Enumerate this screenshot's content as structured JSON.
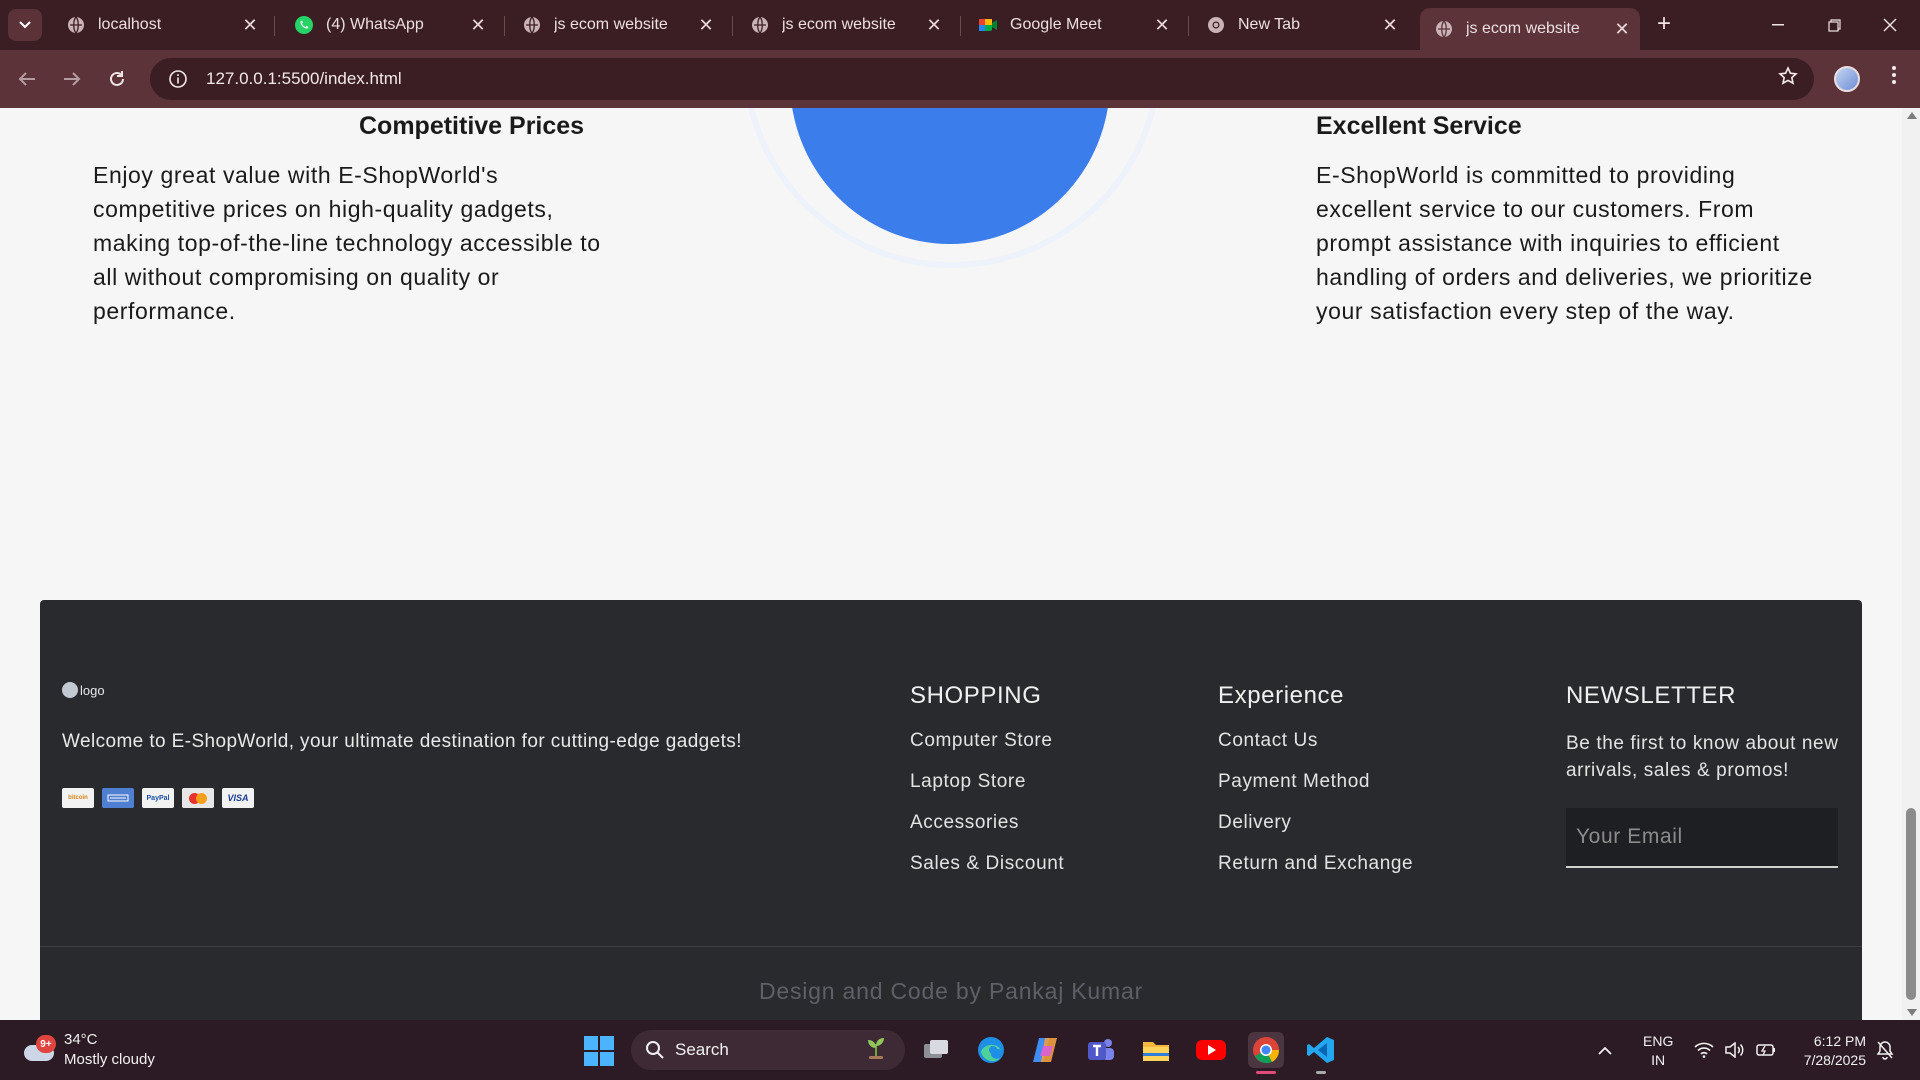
{
  "browser": {
    "tabs": [
      {
        "title": "localhost",
        "icon": "globe-icon",
        "active": false
      },
      {
        "title": "(4) WhatsApp",
        "icon": "whatsapp-icon",
        "active": false
      },
      {
        "title": "js ecom website",
        "icon": "globe-icon",
        "active": false
      },
      {
        "title": "js ecom website",
        "icon": "globe-icon",
        "active": false
      },
      {
        "title": "Google Meet",
        "icon": "google-meet-icon",
        "active": false
      },
      {
        "title": "New Tab",
        "icon": "chrome-icon",
        "active": false
      },
      {
        "title": "js ecom website",
        "icon": "globe-icon",
        "active": true
      }
    ],
    "url": "127.0.0.1:5500/index.html",
    "tab_close_glyph": "✕",
    "new_tab_glyph": "+"
  },
  "features": {
    "left": {
      "title": "Competitive Prices",
      "text": "Enjoy great value with E-ShopWorld's competitive prices on high-quality gadgets, making top-of-the-line technology accessible to all without compromising on quality or performance."
    },
    "right": {
      "title": "Excellent Service",
      "text": "E-ShopWorld is committed to providing excellent service to our customers. From prompt assistance with inquiries to efficient handling of orders and deliveries, we prioritize your satisfaction every step of the way."
    }
  },
  "footer": {
    "logo_alt": "logo",
    "welcome": "Welcome to E-ShopWorld, your ultimate destination for cutting-edge gadgets!",
    "payment_methods": [
      "bitcoin",
      "American Express",
      "PayPal",
      "MasterCard",
      "VISA"
    ],
    "shopping": {
      "heading": "SHOPPING",
      "links": [
        "Computer Store",
        "Laptop Store",
        "Accessories",
        "Sales & Discount"
      ]
    },
    "experience": {
      "heading": "Experience",
      "links": [
        "Contact Us",
        "Payment Method",
        "Delivery",
        "Return and Exchange"
      ]
    },
    "newsletter": {
      "heading": "NEWSLETTER",
      "text": "Be the first to know about new arrivals, sales & promos!",
      "email_placeholder": "Your Email"
    },
    "credit": "Design and Code by Pankaj Kumar"
  },
  "taskbar": {
    "weather": {
      "temp": "34°C",
      "condition": "Mostly cloudy",
      "badge": "9+"
    },
    "search_label": "Search",
    "apps": [
      "task-view-icon",
      "edge-icon",
      "copilot-icon",
      "teams-icon",
      "file-explorer-icon",
      "youtube-icon",
      "chrome-icon",
      "vscode-icon"
    ],
    "language": {
      "line1": "ENG",
      "line2": "IN"
    },
    "time": "6:12 PM",
    "date": "7/28/2025"
  },
  "colors": {
    "accent_blue": "#3b7deb",
    "footer_bg": "#282a2e",
    "tabstrip_bg": "#3b1e23",
    "toolbar_bg": "#5c3339"
  }
}
